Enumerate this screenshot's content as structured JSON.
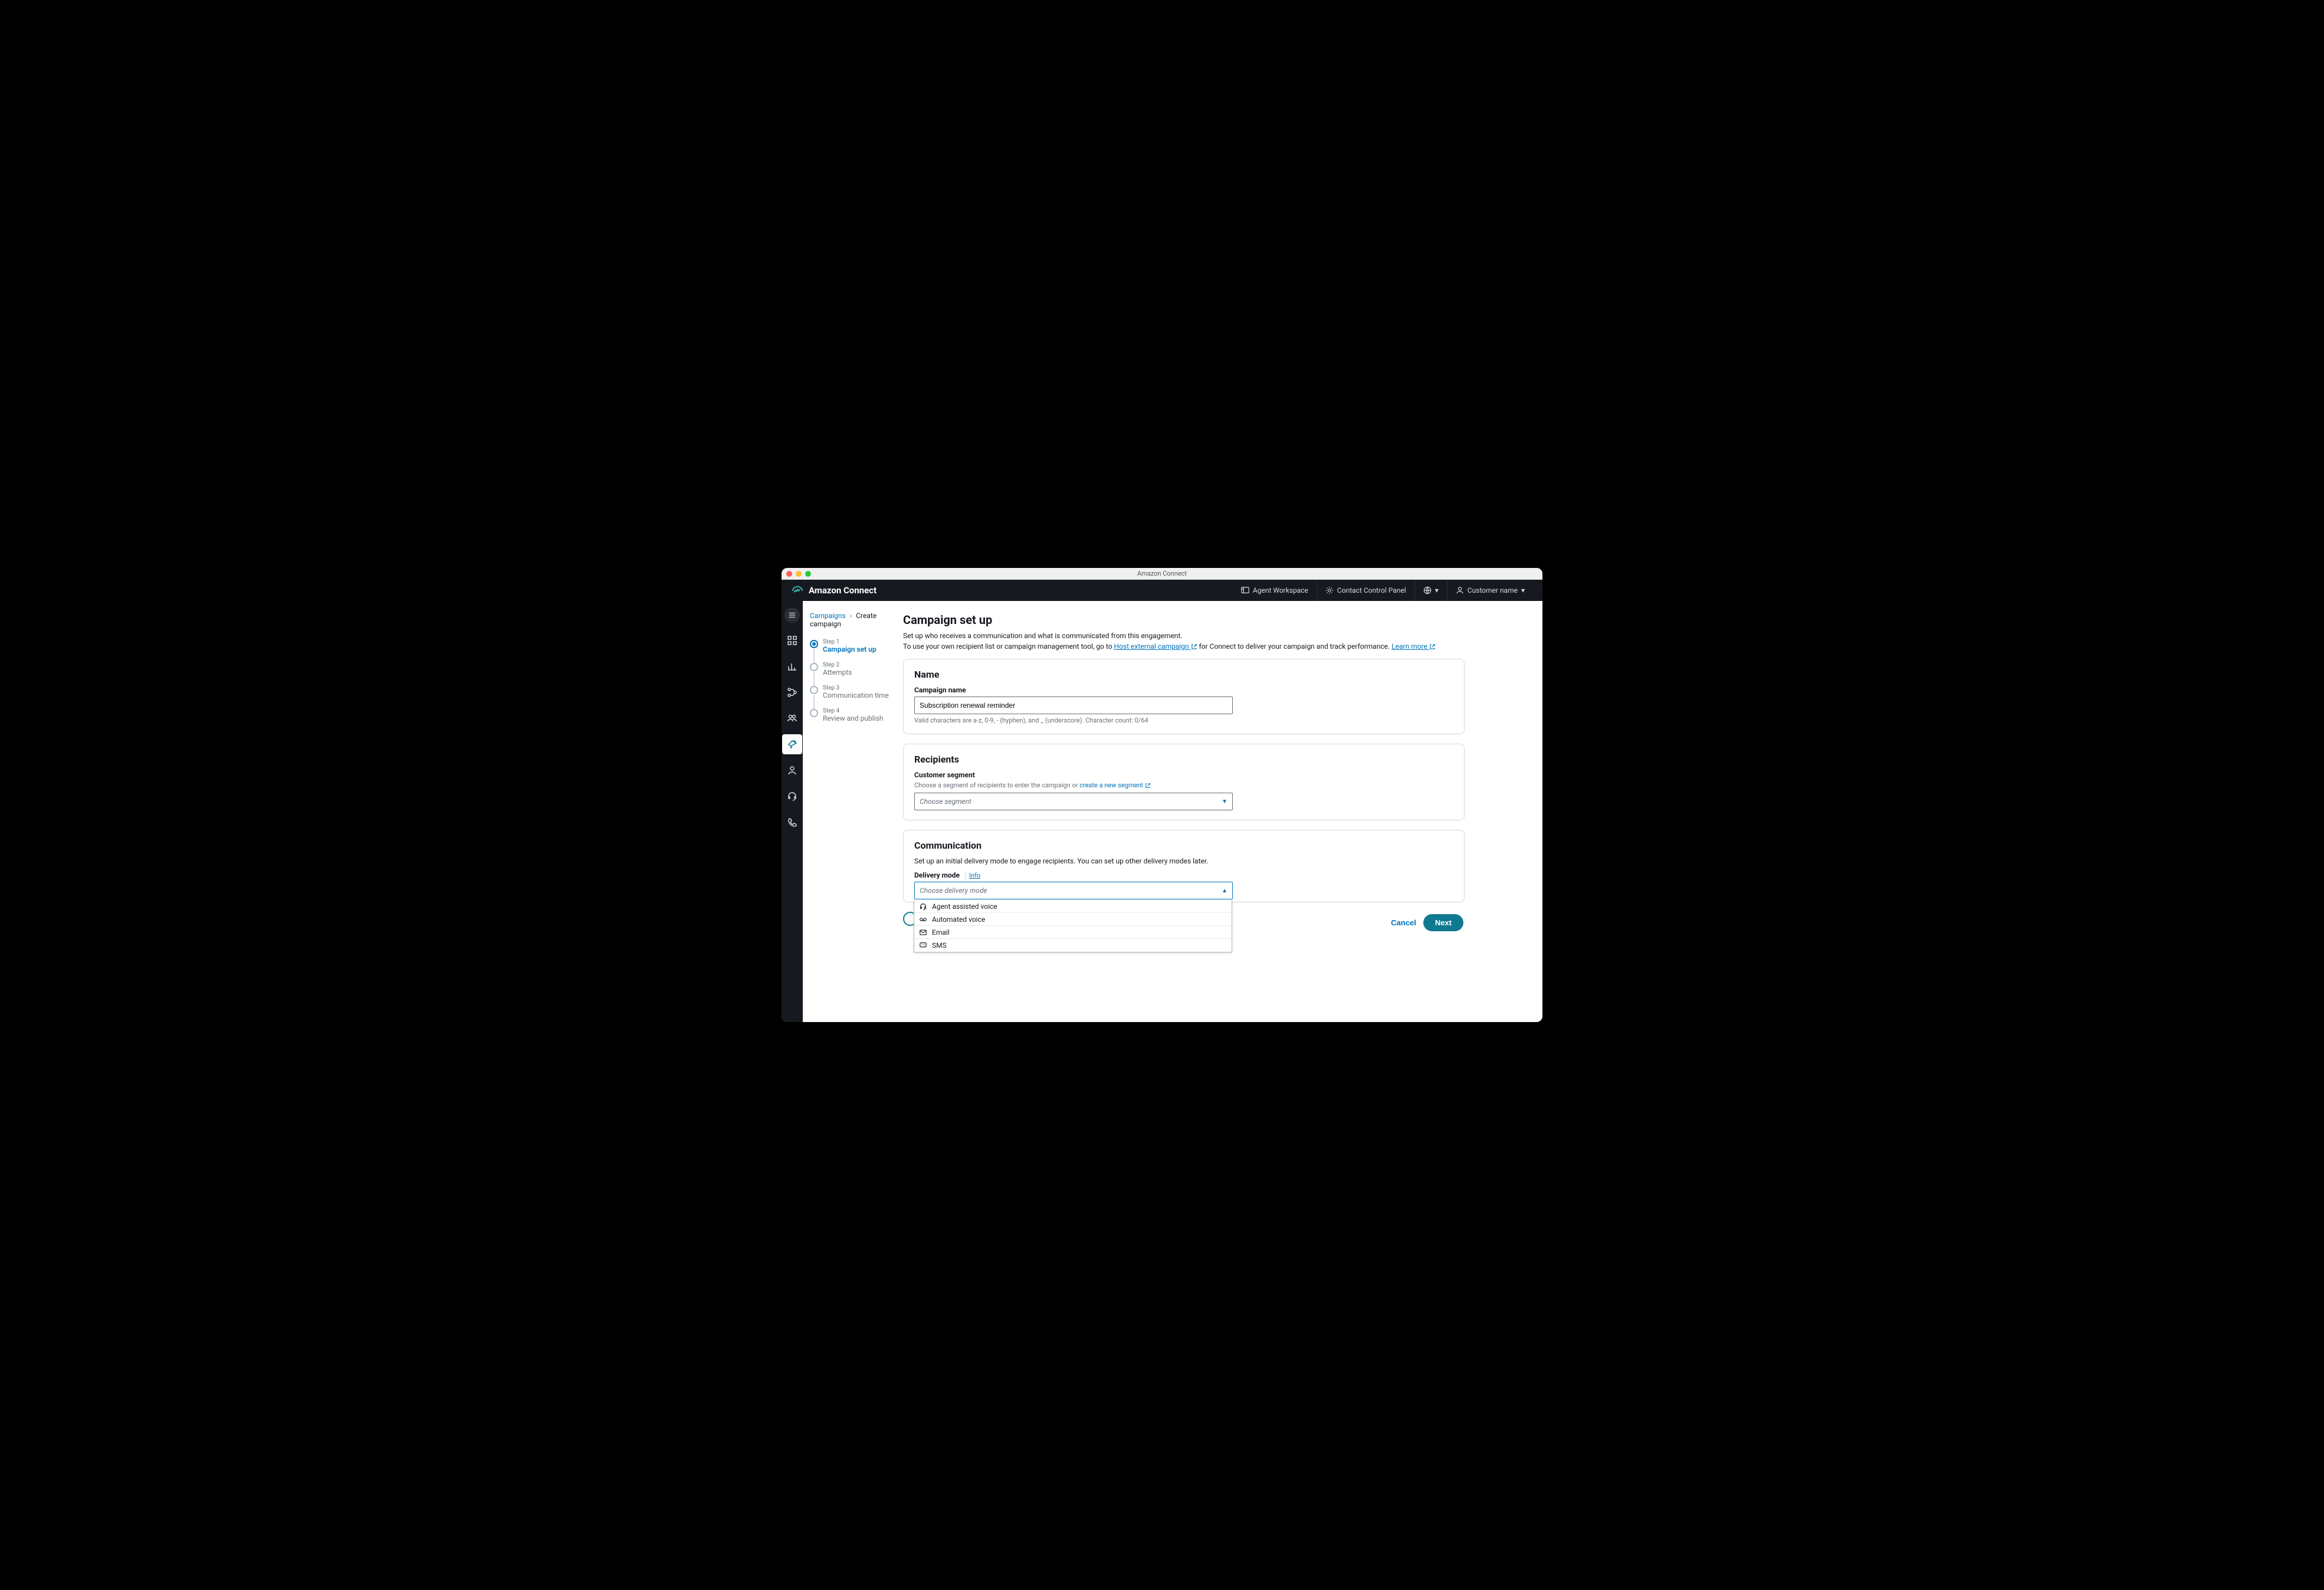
{
  "titlebar": {
    "title": "Amazon Connect"
  },
  "brand": "Amazon Connect",
  "top_nav": {
    "agent_workspace": "Agent Workspace",
    "contact_control": "Contact Control Panel",
    "customer_name": "Customer name"
  },
  "breadcrumb": {
    "root": "Campaigns",
    "current": "Create campaign"
  },
  "wizard": {
    "steps": [
      {
        "num": "Step 1",
        "title": "Campaign set up"
      },
      {
        "num": "Step 2",
        "title": "Attempts"
      },
      {
        "num": "Step 3",
        "title": "Communication time"
      },
      {
        "num": "Step 4",
        "title": "Review and publish"
      }
    ]
  },
  "page": {
    "title": "Campaign set up",
    "intro1": "Set up who receives a communication and what is communicated from this engagement.",
    "intro2a": "To use your own recipient list or campaign management tool, go to ",
    "intro2_link": "Host external campaign",
    "intro2b": " for Connect to deliver your campaign and track performance. ",
    "learn_more": "Learn more"
  },
  "name_card": {
    "heading": "Name",
    "label": "Campaign name",
    "value": "Subscription renewal reminder",
    "hint": "Valid characters are a-z, 0-9, - (hyphen), and _ (underscore). Character count: 0/64"
  },
  "recipients_card": {
    "heading": "Recipients",
    "label": "Customer segment",
    "sub_a": "Choose a segment of recipients to enter the campaign or  ",
    "sub_link": "create a new segment",
    "select_placeholder": "Choose segment"
  },
  "comm_card": {
    "heading": "Communication",
    "sub": "Set up an initial delivery mode to engage recipients. You can set up other delivery modes later.",
    "label": "Delivery mode",
    "info": "Info",
    "select_placeholder": "Choose delivery mode",
    "options": [
      "Agent assisted voice",
      "Automated voice",
      "Email",
      "SMS"
    ]
  },
  "footer": {
    "cancel": "Cancel",
    "next": "Next"
  }
}
